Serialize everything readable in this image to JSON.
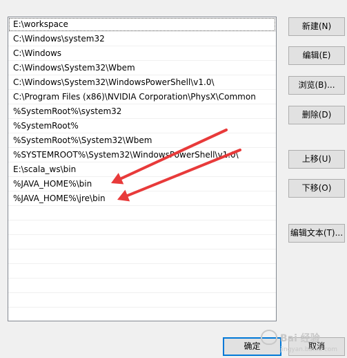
{
  "path_list": {
    "items": [
      "E:\\workspace",
      "C:\\Windows\\system32",
      "C:\\Windows",
      "C:\\Windows\\System32\\Wbem",
      "C:\\Windows\\System32\\WindowsPowerShell\\v1.0\\",
      "C:\\Program Files (x86)\\NVIDIA Corporation\\PhysX\\Common",
      "%SystemRoot%\\system32",
      "%SystemRoot%",
      "%SystemRoot%\\System32\\Wbem",
      "%SYSTEMROOT%\\System32\\WindowsPowerShell\\v1.0\\",
      "E:\\scala_ws\\bin",
      "%JAVA_HOME%\\bin",
      "%JAVA_HOME%\\jre\\bin"
    ],
    "empty_rows": 8
  },
  "buttons": {
    "new": "新建(N)",
    "edit": "编辑(E)",
    "browse": "浏览(B)...",
    "delete": "删除(D)",
    "move_up": "上移(U)",
    "move_down": "下移(O)",
    "edit_text": "编辑文本(T)...",
    "ok": "确定",
    "cancel": "取消"
  },
  "annotations": {
    "arrow_color": "#e83a3a"
  },
  "watermark": {
    "line1": "Bai 经验",
    "line2": "jingyan.baidu.com"
  }
}
